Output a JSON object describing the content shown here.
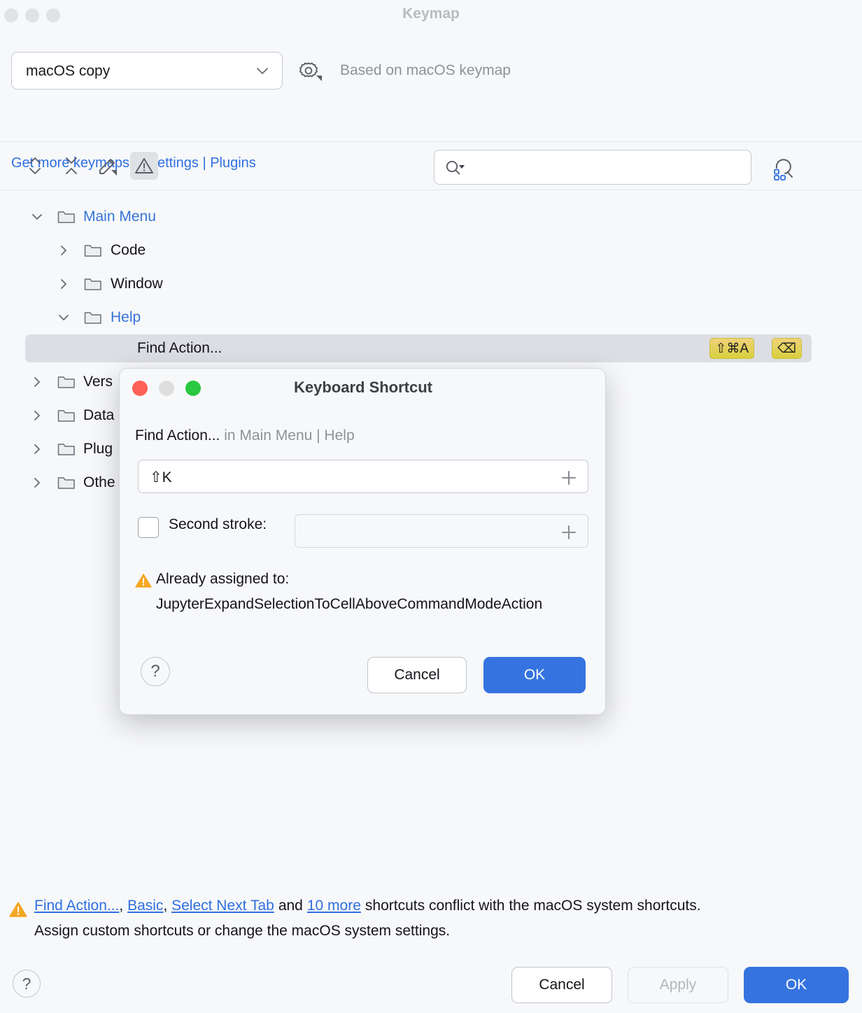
{
  "window": {
    "title": "Keymap",
    "traffic_lights": [
      "close",
      "minimize",
      "zoom"
    ]
  },
  "keymap_selector": {
    "selected": "macOS copy",
    "gear_icon": "gear-icon",
    "based_on": "Based on macOS keymap",
    "plugins_link": "Get more keymaps in Settings | Plugins"
  },
  "toolbar": {
    "buttons": [
      {
        "name": "expand-all-icon",
        "title": "Expand All"
      },
      {
        "name": "collapse-all-icon",
        "title": "Collapse All"
      },
      {
        "name": "edit-shortcut-icon",
        "title": "Edit Shortcut"
      },
      {
        "name": "show-conflicts-icon",
        "title": "Show Conflicts",
        "active": true
      }
    ],
    "search": {
      "value": "",
      "placeholder": "",
      "icon": "search-icon"
    },
    "find_by_shortcut_icon": "find-by-shortcut-icon"
  },
  "tree": {
    "rows": [
      {
        "label": "Main Menu",
        "indent": 0,
        "twisty": "down",
        "color": "blue",
        "folder": true
      },
      {
        "label": "Code",
        "indent": 1,
        "twisty": "right",
        "color": "dark",
        "folder": true
      },
      {
        "label": "Window",
        "indent": 1,
        "twisty": "right",
        "color": "dark",
        "folder": true
      },
      {
        "label": "Help",
        "indent": 1,
        "twisty": "down",
        "color": "blue",
        "folder": true
      },
      {
        "label": "Find Action...",
        "indent": 2,
        "twisty": "none",
        "color": "dark",
        "folder": false,
        "selected": true,
        "shortcuts": [
          "⇧⌘A",
          "⌫"
        ]
      },
      {
        "label": "Vers",
        "indent": 0,
        "twisty": "right",
        "color": "dark",
        "folder": true
      },
      {
        "label": "Data",
        "indent": 0,
        "twisty": "right",
        "color": "dark",
        "folder": true
      },
      {
        "label": "Plug",
        "indent": 0,
        "twisty": "right",
        "color": "dark",
        "folder": true
      },
      {
        "label": "Othe",
        "indent": 0,
        "twisty": "right",
        "color": "dark",
        "folder": true
      }
    ]
  },
  "dialog": {
    "title": "Keyboard Shortcut",
    "action_name": "Find Action...",
    "context": "in Main Menu | Help",
    "first_stroke": "⇧K",
    "second_stroke_label": "Second stroke:",
    "second_stroke_value": "",
    "second_stroke_checked": false,
    "already_assigned_label": "Already assigned to:",
    "already_assigned_value": "JupyterExpandSelectionToCellAboveCommandModeAction",
    "help_glyph": "?",
    "cancel_label": "Cancel",
    "ok_label": "OK"
  },
  "bottom_warning": {
    "links": [
      "Find Action...",
      "Basic",
      "Select Next Tab",
      "10 more"
    ],
    "text_and": "and",
    "text_tail": "shortcuts conflict with the macOS system shortcuts.",
    "line2": "Assign custom shortcuts or change the macOS system settings."
  },
  "footer": {
    "help_glyph": "?",
    "cancel_label": "Cancel",
    "apply_label": "Apply",
    "apply_disabled": true,
    "ok_label": "OK"
  },
  "colors": {
    "accent_blue": "#3574e0",
    "link_blue": "#2f6fe0",
    "warning_yellow": "#f5a623",
    "badge_gold": "#d9cf3e",
    "selection_gray": "#dcdee3"
  }
}
